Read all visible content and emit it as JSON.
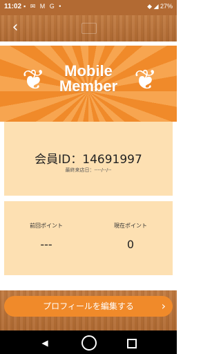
{
  "status_bar": {
    "time": "11:02",
    "notification_icons": "▪ ✉ M G •",
    "battery": "27%"
  },
  "header": {
    "back_icon": "chevron-left-icon"
  },
  "hero": {
    "title": "Mobile Member"
  },
  "member": {
    "id_text": "会員ID：14691997",
    "last_visit": "最終来店日：----/--/--"
  },
  "points": {
    "previous_label": "前回ポイント",
    "previous_value": "---",
    "current_label": "現在ポイント",
    "current_value": "0"
  },
  "actions": {
    "edit_profile_label": "プロフィールを編集する"
  },
  "colors": {
    "accent": "#f08a2a",
    "panel": "#fde0b2",
    "wood": "#b06a32"
  }
}
